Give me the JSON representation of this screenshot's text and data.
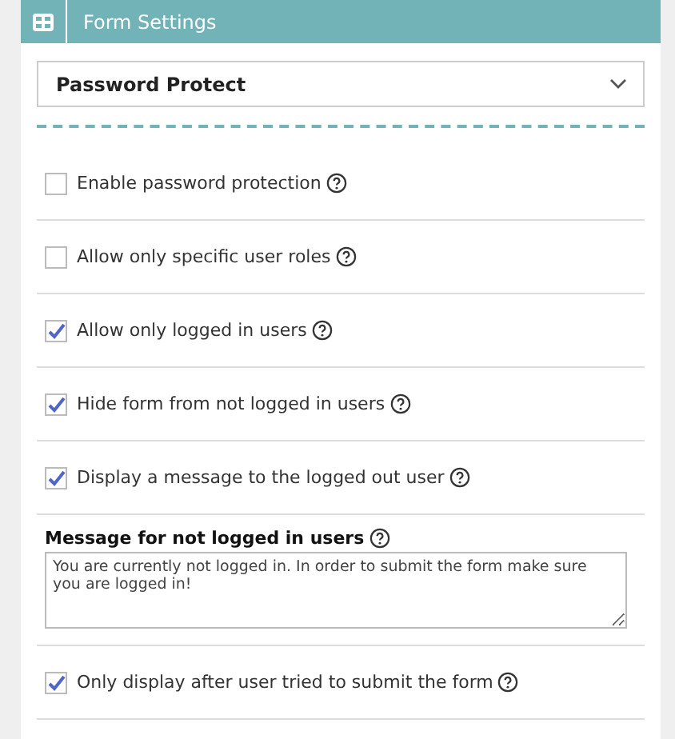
{
  "header": {
    "title": "Form Settings"
  },
  "section_select": {
    "value": "Password Protect"
  },
  "items": [
    {
      "kind": "checkbox",
      "label": "Enable password protection",
      "checked": false
    },
    {
      "kind": "checkbox",
      "label": "Allow only specific user roles",
      "checked": false
    },
    {
      "kind": "checkbox",
      "label": "Allow only logged in users",
      "checked": true
    },
    {
      "kind": "checkbox",
      "label": "Hide form from not logged in users",
      "checked": true
    },
    {
      "kind": "checkbox",
      "label": "Display a message to the logged out user",
      "checked": true
    },
    {
      "kind": "textarea",
      "label": "Message for not logged in users",
      "value": "You are currently not logged in. In order to submit the form make sure you are logged in!"
    },
    {
      "kind": "checkbox",
      "label": "Only display after user tried to submit the form",
      "checked": true
    }
  ]
}
